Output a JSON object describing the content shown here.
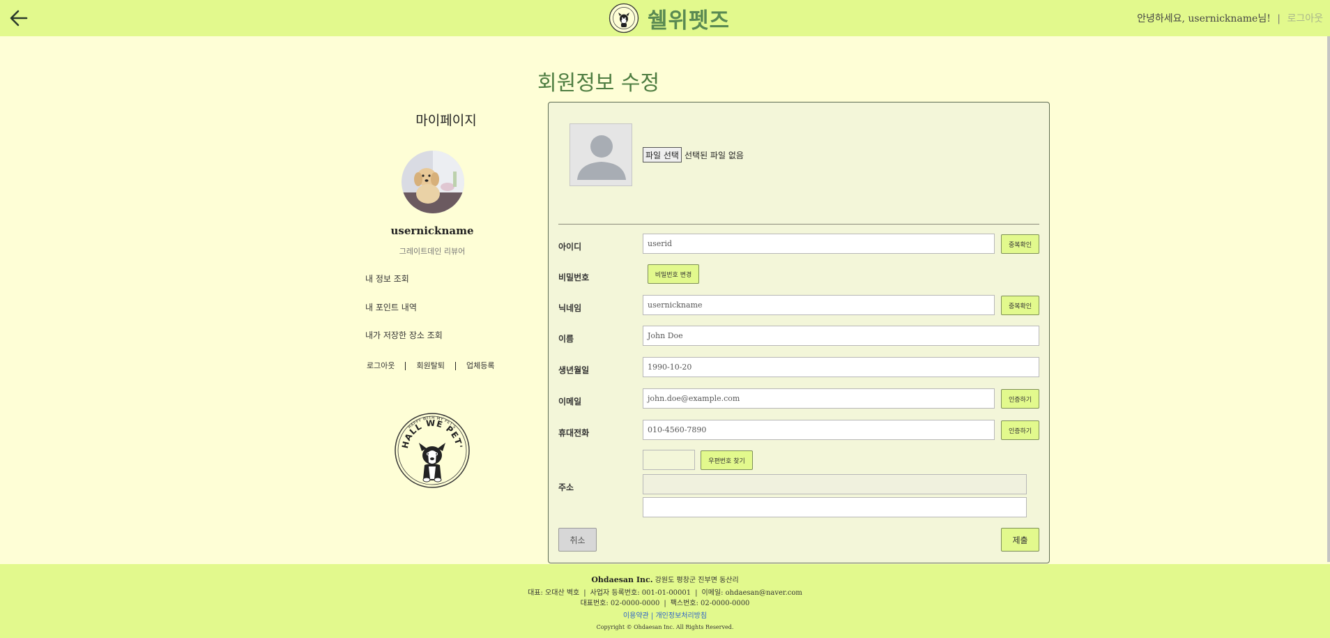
{
  "header": {
    "back_icon": "arrow-left-icon",
    "logo_text": "쉘위펫즈",
    "greeting": "안녕하세요, usernickname님!",
    "separator": "|",
    "logout_label": "로그아웃"
  },
  "page_title": "회원정보 수정",
  "sidebar": {
    "heading": "마이페이지",
    "nickname": "usernickname",
    "grade": "그레이트데인 리뷰어",
    "links": [
      "내 정보 조회",
      "내 포인트 내역",
      "내가 저장한 장소 조회"
    ],
    "bottom_links": [
      "로그아웃",
      "회원탈퇴",
      "업체등록"
    ],
    "stamp_text": "SHALL WE PET'S",
    "stamp_subtext": "HAPPY WITH MY PET'S"
  },
  "form": {
    "file_button_label": "파일 선택",
    "file_status": "선택된 파일 없음",
    "id_label": "아이디",
    "id_value": "userid",
    "check_dup_label": "중복확인",
    "password_label": "비밀번호",
    "change_password_label": "비밀번호 변경",
    "nickname_label": "닉네임",
    "nickname_value": "usernickname",
    "name_label": "이름",
    "name_value": "John Doe",
    "birth_label": "생년월일",
    "birth_value": "1990-10-20",
    "email_label": "이메일",
    "email_value": "john.doe@example.com",
    "verify_label": "인증하기",
    "phone_label": "휴대전화",
    "phone_value": "010-4560-7890",
    "postcode_value": "",
    "find_postcode_label": "우편번호 찾기",
    "address_label": "주소",
    "address_value": "",
    "address_detail_value": "",
    "cancel_label": "취소",
    "submit_label": "제출"
  },
  "footer": {
    "company": "Ohdaesan Inc.",
    "location": "강원도 평창군 진부면 동산리",
    "ceo": "대표: 오대산 벽호",
    "biz_no": "사업자 등록번호: 001-01-00001",
    "email": "이메일: ohdaesan@naver.com",
    "phone": "대표번호: 02-0000-0000",
    "fax": "팩스번호: 02-0000-0000",
    "terms": "이용약관",
    "privacy": "개인정보처리방침",
    "copyright": "Copyright © Ohdaesan Inc. All Rights Reserved."
  },
  "colors": {
    "header_bg": "#e2f98d",
    "page_bg": "#fefed6",
    "card_bg": "#f3f6d9",
    "title_green": "#4e7d41",
    "logo_green": "#5a8a52",
    "link_blue": "#2d62c9"
  }
}
